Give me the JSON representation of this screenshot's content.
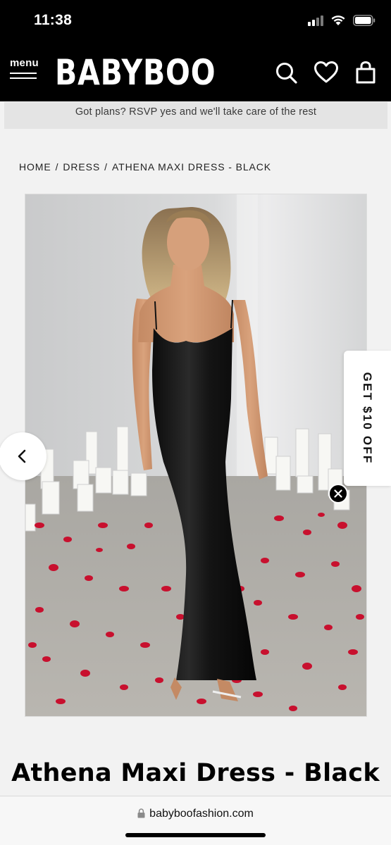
{
  "status_bar": {
    "time": "11:38"
  },
  "header": {
    "menu_label": "menu",
    "logo": "BABYBOO",
    "icons": [
      "search-icon",
      "heart-icon",
      "shopping-bag-icon"
    ]
  },
  "announcement": "Got plans? RSVP yes and we'll take care of the rest",
  "breadcrumb": {
    "home": "HOME",
    "category": "DRESS",
    "current": "ATHENA MAXI DRESS - BLACK",
    "separator": "/"
  },
  "promo_tab": {
    "label": "GET $10 OFF"
  },
  "product": {
    "title": "Athena Maxi Dress - Black"
  },
  "browser": {
    "url": "babyboofashion.com"
  },
  "colors": {
    "header_bg": "#000000",
    "announcement_bg": "#e4e4e4",
    "page_bg": "#f2f2f2",
    "petals": "#c8102e"
  }
}
